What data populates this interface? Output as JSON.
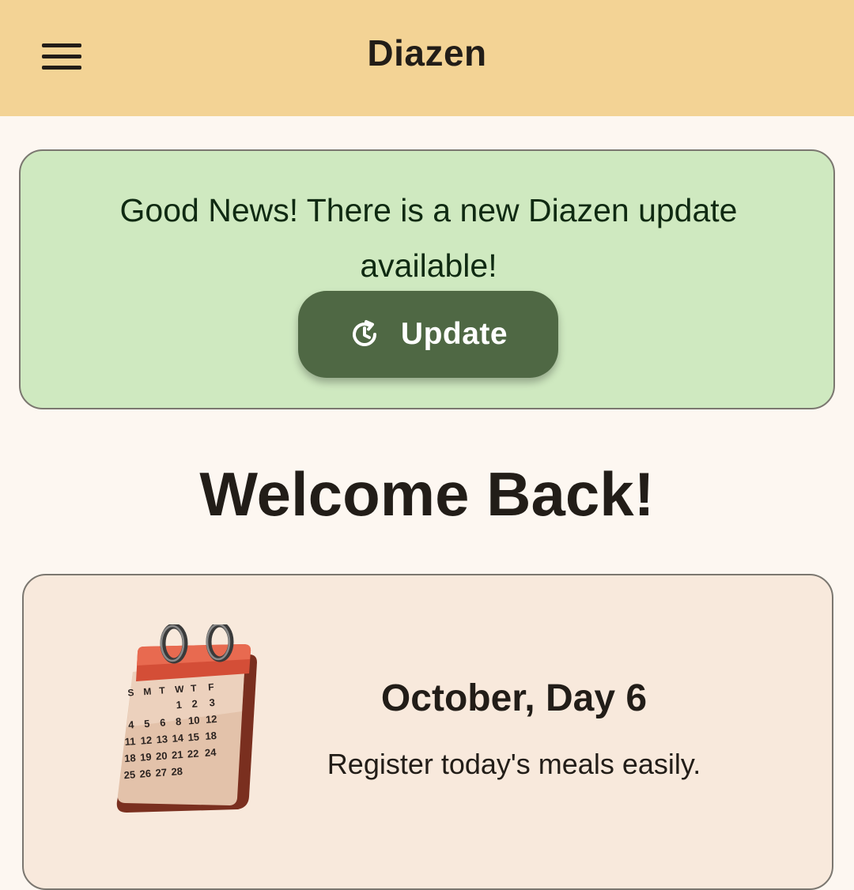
{
  "app_bar": {
    "title": "Diazen",
    "menu_icon": "hamburger-menu-icon"
  },
  "update_banner": {
    "message": "Good News! There is a new Diazen update available!",
    "button_label": "Update",
    "button_icon": "refresh-clock-icon",
    "background_color": "#cfe9c0",
    "button_color": "#4f6844"
  },
  "welcome": {
    "heading": "Welcome Back!"
  },
  "day_card": {
    "icon": "calendar-icon",
    "title": "October, Day 6",
    "subtitle": "Register today's meals easily.",
    "calendar": {
      "weekday_letters": [
        "S",
        "M",
        "T",
        "W",
        "T",
        "F"
      ],
      "rows": [
        [
          "",
          "",
          "",
          "1",
          "2",
          "3"
        ],
        [
          "4",
          "5",
          "6",
          "8",
          "10",
          "12"
        ],
        [
          "11",
          "12",
          "13",
          "14",
          "15",
          "18"
        ],
        [
          "18",
          "19",
          "20",
          "21",
          "22",
          "24"
        ],
        [
          "25",
          "26",
          "27",
          "28",
          "",
          ""
        ]
      ]
    }
  },
  "colors": {
    "app_bar": "#f3d395",
    "page_background": "#fdf7f1",
    "card_background": "#f8e9dc",
    "text": "#221d18"
  }
}
